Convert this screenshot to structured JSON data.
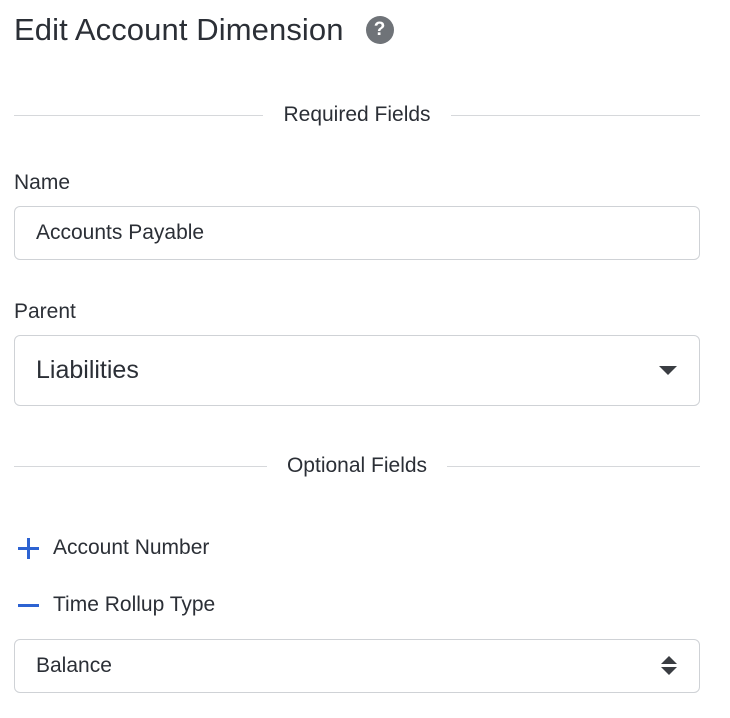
{
  "header": {
    "title": "Edit Account Dimension",
    "help_icon": "question-circle-icon",
    "help_glyph": "?"
  },
  "required_section": {
    "label": "Required Fields",
    "name_field": {
      "label": "Name",
      "value": "Accounts Payable"
    },
    "parent_field": {
      "label": "Parent",
      "selected": "Liabilities",
      "icon": "caret-down-icon"
    }
  },
  "optional_section": {
    "label": "Optional Fields",
    "toggles": [
      {
        "label": "Account Number",
        "state": "collapsed",
        "icon": "plus-icon"
      },
      {
        "label": "Time Rollup Type",
        "state": "expanded",
        "icon": "minus-icon"
      }
    ],
    "time_rollup_field": {
      "selected": "Balance",
      "icon": "up-down-arrows-icon"
    }
  },
  "colors": {
    "accent": "#2d63d2",
    "text": "#2b2f36",
    "border": "#cfd2d6",
    "divider": "#d6d8db",
    "help_icon_bg": "#6f7378"
  }
}
